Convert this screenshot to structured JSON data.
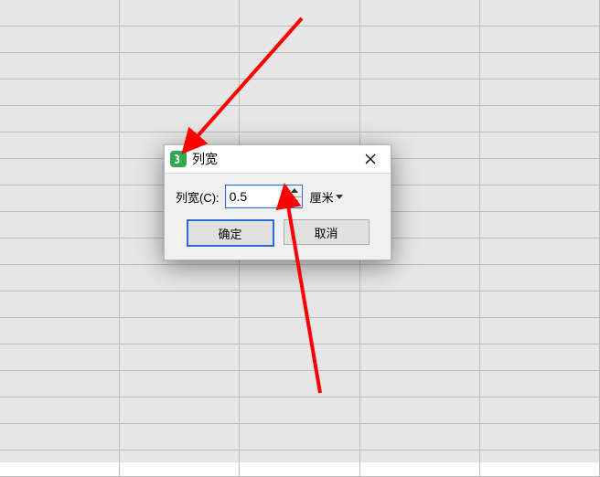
{
  "dialog": {
    "title": "列宽",
    "field_label": "列宽(C):",
    "value": "0.5",
    "unit_label": "厘米",
    "ok_label": "确定",
    "cancel_label": "取消"
  },
  "icons": {
    "app": "spreadsheet-app-icon",
    "close": "close-icon",
    "spin_up": "chevron-up-icon",
    "spin_down": "chevron-down-icon",
    "unit_drop": "chevron-down-icon"
  }
}
